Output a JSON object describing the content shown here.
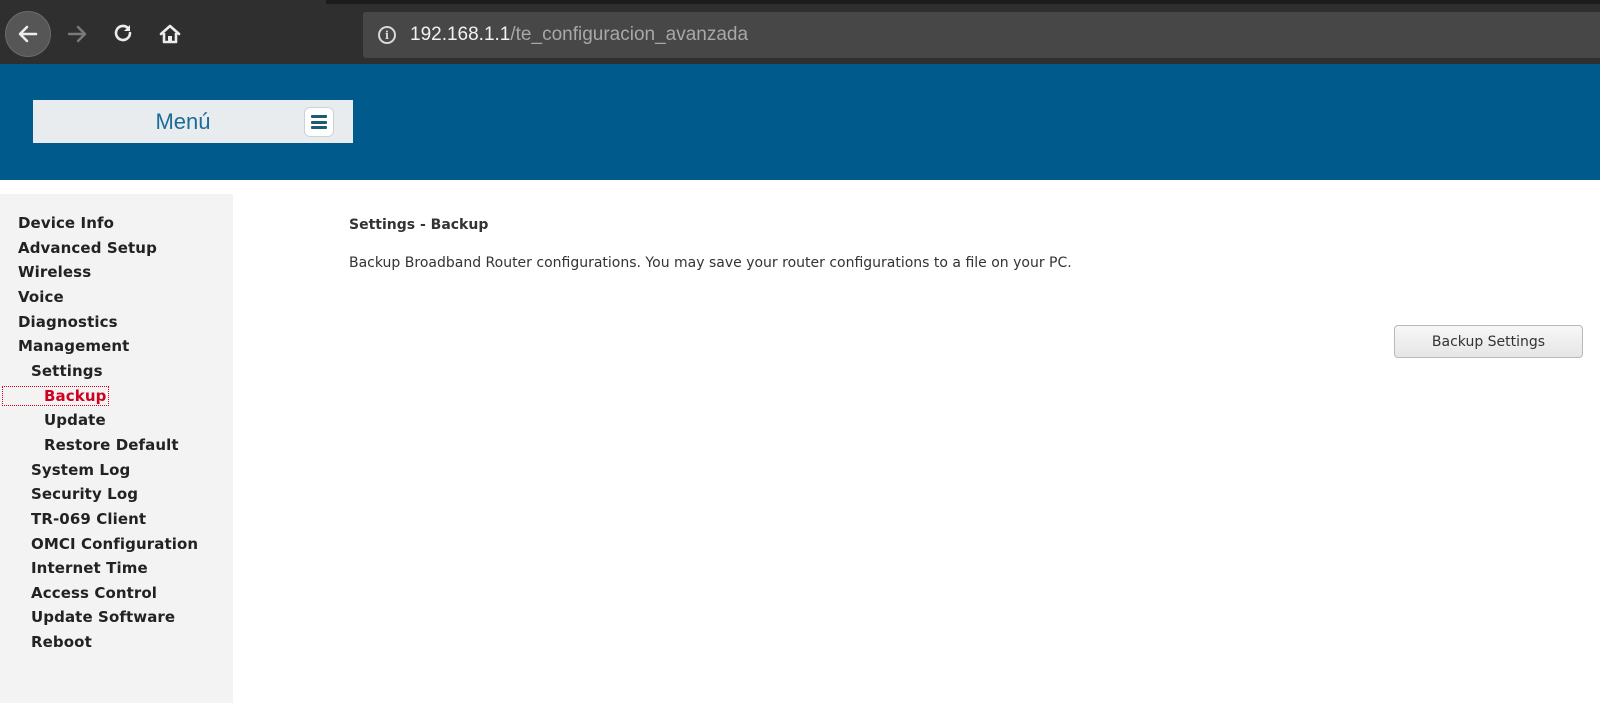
{
  "browser": {
    "url_host": "192.168.1.1",
    "url_path": "/te_configuracion_avanzada",
    "icons": {
      "back": "back-arrow-icon",
      "forward": "forward-arrow-icon",
      "reload": "reload-icon",
      "home": "home-icon",
      "info": "info-icon"
    }
  },
  "header": {
    "menu_label": "Menú",
    "bg_color": "#005a8b"
  },
  "sidebar": {
    "items": [
      {
        "label": "Device Info",
        "level": 0
      },
      {
        "label": "Advanced Setup",
        "level": 0
      },
      {
        "label": "Wireless",
        "level": 0
      },
      {
        "label": "Voice",
        "level": 0
      },
      {
        "label": "Diagnostics",
        "level": 0
      },
      {
        "label": "Management",
        "level": 0
      },
      {
        "label": "Settings",
        "level": 1
      },
      {
        "label": "Backup",
        "level": 2,
        "active": true
      },
      {
        "label": "Update",
        "level": 2
      },
      {
        "label": "Restore Default",
        "level": 2
      },
      {
        "label": "System Log",
        "level": 1
      },
      {
        "label": "Security Log",
        "level": 1
      },
      {
        "label": "TR-069 Client",
        "level": 1
      },
      {
        "label": "OMCI Configuration",
        "level": 1
      },
      {
        "label": "Internet Time",
        "level": 1
      },
      {
        "label": "Access Control",
        "level": 1
      },
      {
        "label": "Update Software",
        "level": 1
      },
      {
        "label": "Reboot",
        "level": 1
      }
    ],
    "active_color": "#d1001f"
  },
  "main": {
    "title": "Settings - Backup",
    "description": "Backup Broadband Router configurations. You may save your router configurations to a file on your PC.",
    "backup_button_label": "Backup Settings"
  }
}
